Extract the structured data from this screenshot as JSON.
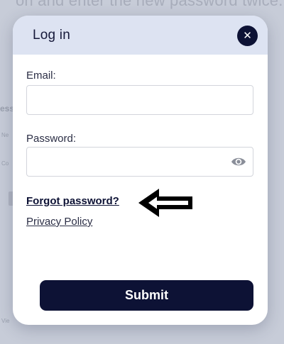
{
  "background": {
    "heading_fragment": "on and enter the new password twice."
  },
  "modal": {
    "title": "Log in",
    "close_icon": "close-icon",
    "email_label": "Email:",
    "email_value": "",
    "password_label": "Password:",
    "password_value": "",
    "password_toggle_icon": "eye-icon",
    "forgot_password_link": "Forgot password?",
    "privacy_policy_link": "Privacy Policy",
    "annotation_icon": "arrow-left-icon",
    "submit_label": "Submit"
  },
  "colors": {
    "header_background": "#dde3f2",
    "primary": "#0d1235",
    "backdrop": "#c7ccd8"
  }
}
